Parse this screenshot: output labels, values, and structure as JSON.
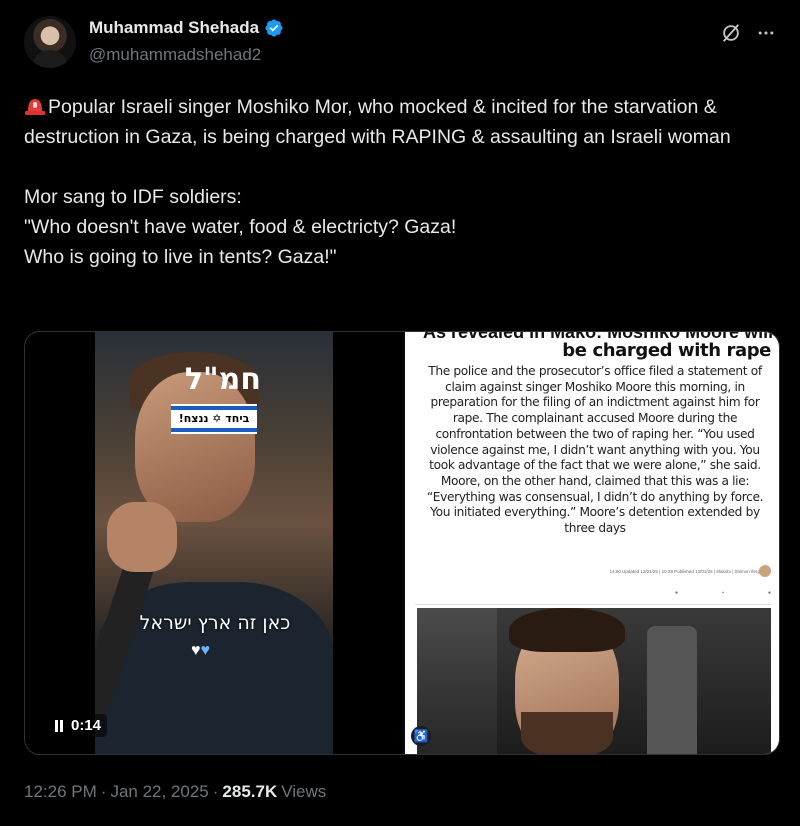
{
  "author": {
    "display_name": "Muhammad Shehada",
    "handle": "@muhammadshehad2"
  },
  "icons": {
    "verified": "verified-badge-icon",
    "grok": "grok-icon",
    "more": "more-icon",
    "siren": "police-light-icon"
  },
  "colors": {
    "verified": "#1d9bf0",
    "secondary_text": "#71767b"
  },
  "tweet": {
    "line1": "Popular Israeli singer Moshiko Mor, who mocked & incited for the starvation & destruction in Gaza, is being charged with RAPING & assaulting an Israeli woman",
    "line2": "Mor sang to IDF soldiers:\n\"Who doesn't have water, food & electricty? Gaza!\nWho is going to live in tents? Gaza!\""
  },
  "video": {
    "flag_label": "חמ\"ל",
    "flag_text": "ביחד ✡ ננצח!",
    "overlay_text": "כאן זה ארץ ישראל",
    "hearts": "🤍💙",
    "time": "0:14",
    "playing": true
  },
  "article": {
    "cut_headline": "As revealed in Mako: Moshiko Moore will",
    "headline": "be charged with rape",
    "body": "The police and the prosecutor’s office filed a statement of claim against singer Moshiko Moore this morning, in preparation for the filing of an indictment against him for rape. The complainant accused Moore during the confrontation between the two of raping her. “You used violence against me, I didn’t want anything with you. You took advantage of the fact that we were alone,” she said. Moore, on the other hand, claimed that this was a lie: “Everything was consensual, I didn’t do anything by force. You initiated everything.” Moore’s detention extended by three days",
    "meta": "14:50 Updated 12/01/25 | 10:28 Published 12/01/25 | Makobi | Shimon Ifergan"
  },
  "footer": {
    "time": "12:26 PM",
    "separator": "·",
    "date": "Jan 22, 2025",
    "views_count": "285.7K",
    "views_label": "Views"
  }
}
